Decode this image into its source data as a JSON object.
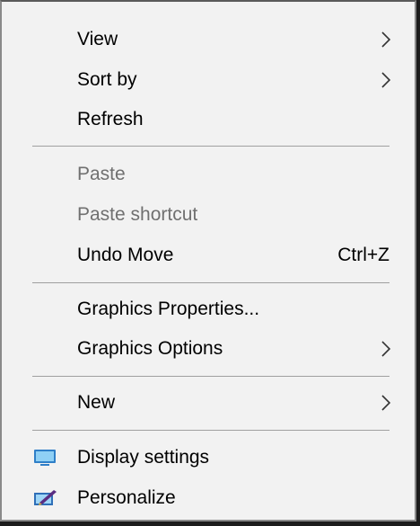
{
  "context_menu": {
    "items": [
      {
        "label": "View",
        "icon": "chevron-right-icon"
      },
      {
        "label": "Sort by",
        "icon": "chevron-right-icon"
      },
      {
        "label": "Refresh"
      },
      {
        "label": "Paste",
        "state": "disabled"
      },
      {
        "label": "Paste shortcut",
        "state": "disabled"
      },
      {
        "label": "Undo Move",
        "shortcut": "Ctrl+Z"
      },
      {
        "label": "Graphics Properties..."
      },
      {
        "label": "Graphics Options",
        "icon": "chevron-right-icon"
      },
      {
        "label": "New",
        "icon": "chevron-right-icon"
      },
      {
        "label": "Display settings",
        "icon": "display-settings-icon"
      },
      {
        "label": "Personalize",
        "icon": "personalize-icon"
      }
    ]
  },
  "colors": {
    "menu_background": "#f2f2f2",
    "disabled_text": "#707070",
    "separator": "#a0a0a0"
  }
}
